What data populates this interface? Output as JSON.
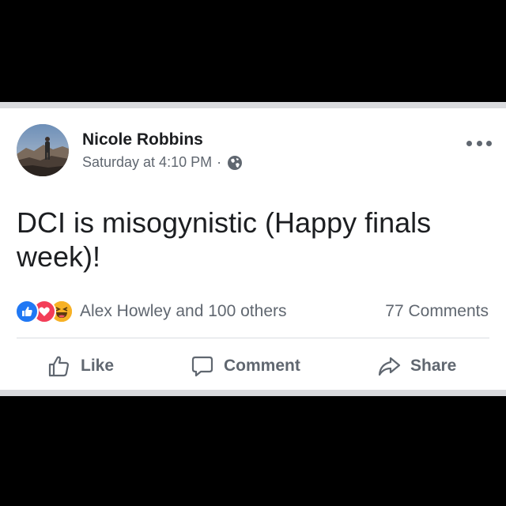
{
  "post": {
    "author": "Nicole Robbins",
    "timestamp": "Saturday at 4:10 PM",
    "separator": "·",
    "privacy_icon": "globe-icon",
    "text": "DCI is misogynistic (Happy finals week)!",
    "reactions": {
      "icons": [
        "like-reaction-icon",
        "love-reaction-icon",
        "haha-reaction-icon"
      ],
      "summary": "Alex Howley and 100 others"
    },
    "comments_count": "77 Comments"
  },
  "actions": {
    "like": "Like",
    "comment": "Comment",
    "share": "Share"
  },
  "colors": {
    "like": "#2078f4",
    "love": "#f33e58",
    "haha": "#f7b125",
    "text_secondary": "#606770"
  }
}
